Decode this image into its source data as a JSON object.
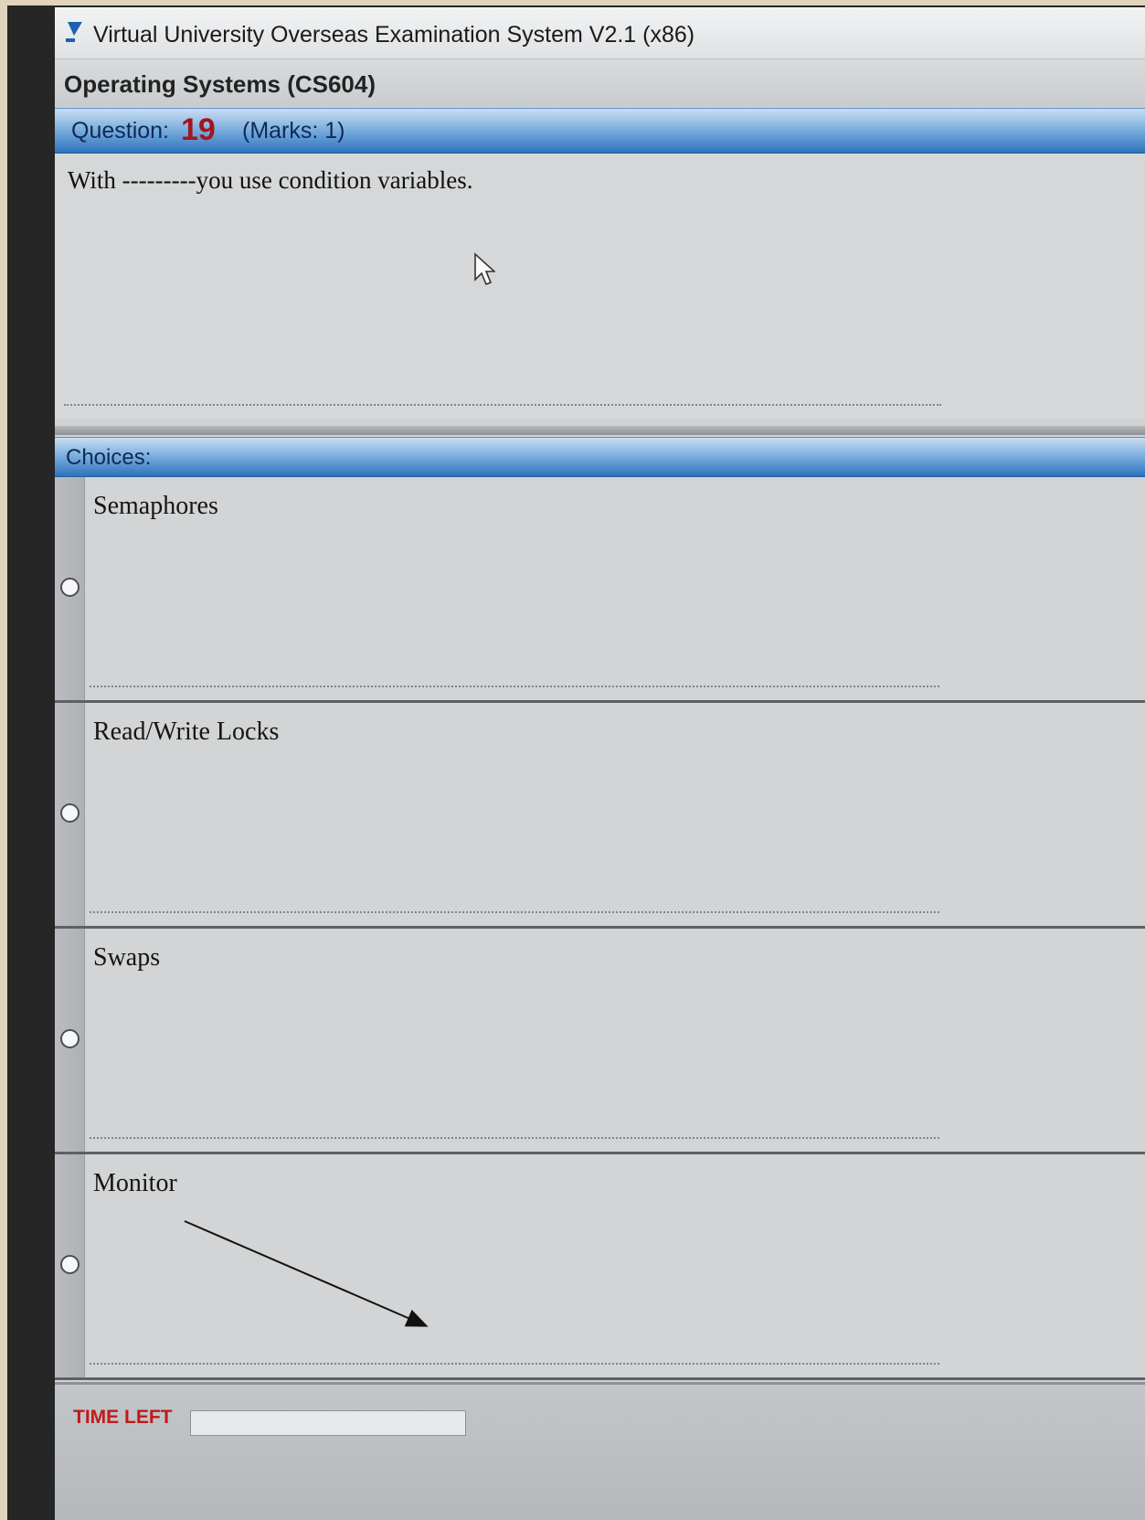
{
  "window": {
    "title": "Virtual University Overseas Examination System  V2.1 (x86)"
  },
  "course": {
    "title": "Operating Systems  (CS604)"
  },
  "question": {
    "label": "Question:",
    "number": "19",
    "marks": "(Marks: 1)",
    "text": "With ---------you use condition variables."
  },
  "choices": {
    "label": "Choices:",
    "options": [
      {
        "label": "Semaphores"
      },
      {
        "label": "Read/Write Locks"
      },
      {
        "label": "Swaps"
      },
      {
        "label": "Monitor"
      }
    ]
  },
  "status": {
    "time_left_label": "TIME LEFT"
  },
  "colors": {
    "header_blue": "#2f72bb",
    "question_number": "#a5151c",
    "time_left": "#c01a1a"
  }
}
